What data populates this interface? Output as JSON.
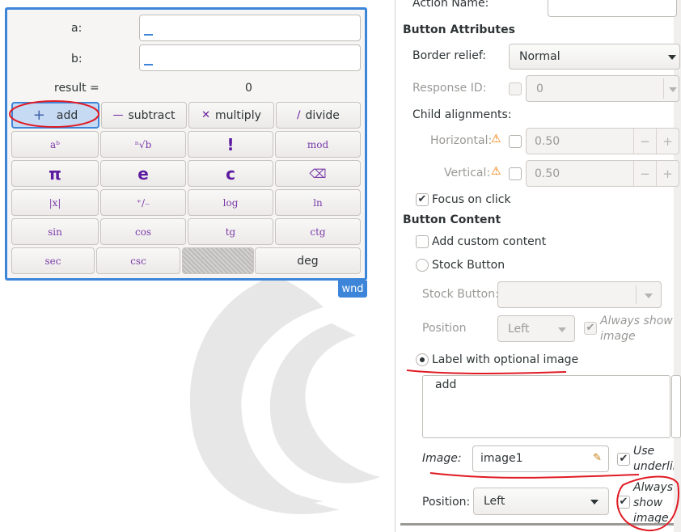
{
  "window": {
    "tag": "wnd",
    "label_a": "a:",
    "label_b": "b:",
    "result_label": "result =",
    "result_value": "0",
    "row1": [
      {
        "name": "add-button",
        "label": "add",
        "icon": "+",
        "active": true
      },
      {
        "name": "subtract-button",
        "label": "subtract",
        "icon": "—"
      },
      {
        "name": "multiply-button",
        "label": "multiply",
        "icon": "✕"
      },
      {
        "name": "divide-button",
        "label": "divide",
        "icon": "∕"
      }
    ],
    "glyph_rows": [
      [
        "aᵇ",
        "ⁿ√b",
        "!",
        "mod"
      ],
      [
        "π",
        "e",
        "c",
        "⌫"
      ],
      [
        "|x|",
        "⁺∕₋",
        "log",
        "ln"
      ],
      [
        "sin",
        "cos",
        "tg",
        "ctg"
      ]
    ],
    "last_row": {
      "sec": "sec",
      "csc": "csc",
      "deg": "deg"
    }
  },
  "panel": {
    "action_name_label": "Action Name:",
    "button_attributes": "Button Attributes",
    "border_relief_label": "Border relief:",
    "border_relief_value": "Normal",
    "response_id_label": "Response ID:",
    "response_id_value": "0",
    "child_alignments": "Child alignments:",
    "horizontal_label": "Horizontal:",
    "horizontal_value": "0.50",
    "vertical_label": "Vertical:",
    "vertical_value": "0.50",
    "focus_on_click": "Focus on click",
    "button_content": "Button Content",
    "add_custom_content": "Add custom content",
    "stock_button_radio": "Stock Button",
    "stock_button_label": "Stock Button:",
    "position_label_dim": "Position",
    "position_dim_value": "Left",
    "always_show_image_dim": "Always show image",
    "label_with_optional_image": "Label with optional image",
    "label_text": "add",
    "image_label": "Image:",
    "image_value": "image1",
    "use_underline": "Use underline",
    "position_label": "Position:",
    "position_value": "Left",
    "always_show_image": "Always show image"
  },
  "colors": {
    "accent": "#3d85d9",
    "annotation": "#e01b24",
    "glyph": "#6a1b9a"
  },
  "icons": {
    "warning": "warning-icon",
    "edit": "edit-icon",
    "minus": "minus-icon",
    "plus": "plus-icon"
  }
}
